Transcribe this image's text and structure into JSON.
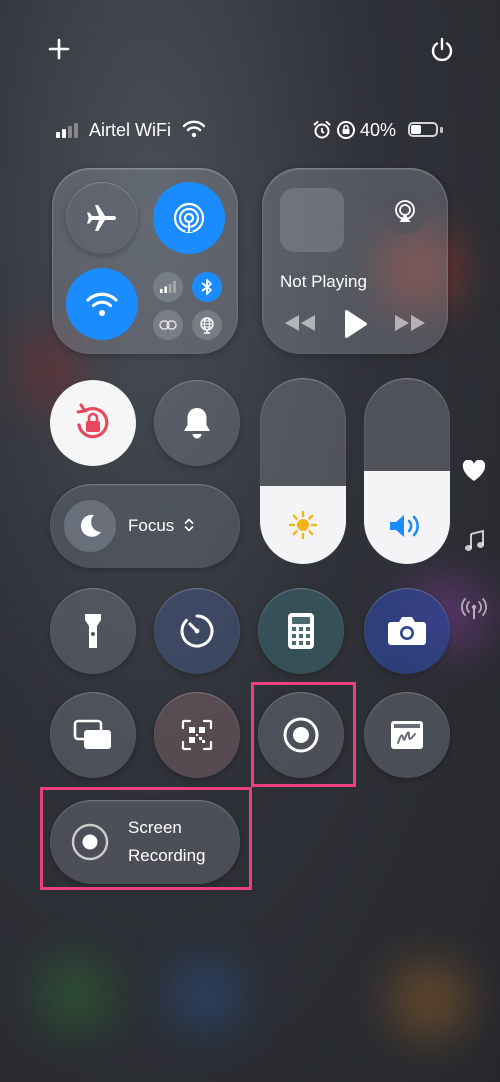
{
  "status": {
    "carrier": "Airtel WiFi",
    "battery": "40%",
    "battery_level": 0.4
  },
  "focus": {
    "label": "Focus"
  },
  "media": {
    "now_playing": "Not Playing"
  },
  "sliders": {
    "brightness_level": 0.42,
    "volume_level": 0.5
  },
  "screen_recording": {
    "line1": "Screen",
    "line2": "Recording"
  },
  "colors": {
    "accent_blue": "#1a8cff",
    "highlight_pink": "#ec3f7c",
    "lock_red": "#e9475b"
  },
  "icons": [
    "plus-icon",
    "power-icon",
    "wifi-icon",
    "airplane-icon",
    "airdrop-icon",
    "cellular-icon",
    "bluetooth-icon",
    "link-icon",
    "globe-icon",
    "airplay-icon",
    "rewind-icon",
    "play-icon",
    "forward-icon",
    "orientation-lock-icon",
    "bell-icon",
    "moon-icon",
    "chevron-updown-icon",
    "sun-icon",
    "speaker-icon",
    "heart-icon",
    "music-note-icon",
    "broadcast-icon",
    "flashlight-icon",
    "timer-icon",
    "calculator-icon",
    "camera-icon",
    "screen-mirroring-icon",
    "qr-code-icon",
    "record-icon",
    "signature-icon"
  ]
}
